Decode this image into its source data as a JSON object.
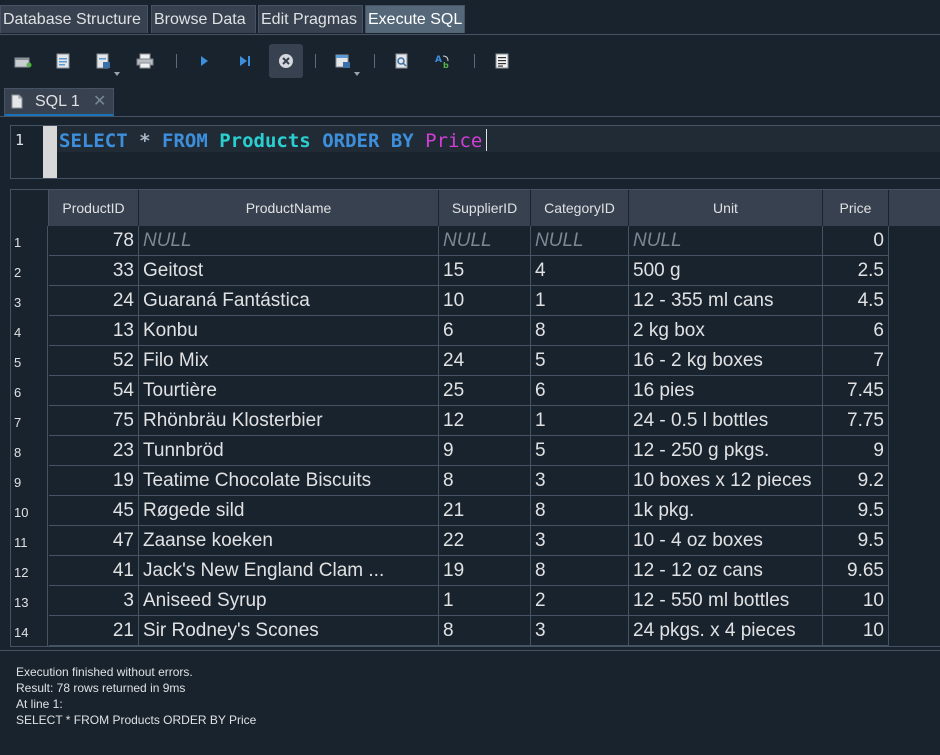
{
  "main_tabs": [
    {
      "label": "Database Structure",
      "active": false
    },
    {
      "label": "Browse Data",
      "active": false
    },
    {
      "label": "Edit Pragmas",
      "active": false
    },
    {
      "label": "Execute SQL",
      "active": true
    }
  ],
  "toolbar": {
    "buttons": [
      "open-tab-icon",
      "open-sql-file-icon",
      "save-sql-file-icon",
      "print-icon",
      "execute-all-icon",
      "execute-line-icon",
      "stop-execution-icon",
      "save-results-icon",
      "find-icon",
      "find-replace-icon",
      "comment-icon"
    ]
  },
  "sql_tab": {
    "label": "SQL 1",
    "close": "✕"
  },
  "editor": {
    "line_number": "1",
    "tokens": {
      "select": "SELECT",
      "star": "*",
      "from": "FROM",
      "table": "Products",
      "order_by": "ORDER BY",
      "column": "Price"
    }
  },
  "results": {
    "columns": [
      "ProductID",
      "ProductName",
      "SupplierID",
      "CategoryID",
      "Unit",
      "Price"
    ],
    "rows": [
      {
        "n": "1",
        "id": "78",
        "name": "NULL",
        "supplier": "NULL",
        "category": "NULL",
        "unit": "NULL",
        "price": "0"
      },
      {
        "n": "2",
        "id": "33",
        "name": "Geitost",
        "supplier": "15",
        "category": "4",
        "unit": "500 g",
        "price": "2.5"
      },
      {
        "n": "3",
        "id": "24",
        "name": "Guaraná Fantástica",
        "supplier": "10",
        "category": "1",
        "unit": "12 - 355 ml cans",
        "price": "4.5"
      },
      {
        "n": "4",
        "id": "13",
        "name": "Konbu",
        "supplier": "6",
        "category": "8",
        "unit": "2 kg box",
        "price": "6"
      },
      {
        "n": "5",
        "id": "52",
        "name": "Filo Mix",
        "supplier": "24",
        "category": "5",
        "unit": "16 - 2 kg boxes",
        "price": "7"
      },
      {
        "n": "6",
        "id": "54",
        "name": "Tourtière",
        "supplier": "25",
        "category": "6",
        "unit": "16 pies",
        "price": "7.45"
      },
      {
        "n": "7",
        "id": "75",
        "name": "Rhönbräu Klosterbier",
        "supplier": "12",
        "category": "1",
        "unit": "24 - 0.5 l bottles",
        "price": "7.75"
      },
      {
        "n": "8",
        "id": "23",
        "name": "Tunnbröd",
        "supplier": "9",
        "category": "5",
        "unit": "12 - 250 g pkgs.",
        "price": "9"
      },
      {
        "n": "9",
        "id": "19",
        "name": "Teatime Chocolate Biscuits",
        "supplier": "8",
        "category": "3",
        "unit": "10 boxes x 12 pieces",
        "price": "9.2"
      },
      {
        "n": "10",
        "id": "45",
        "name": "Røgede sild",
        "supplier": "21",
        "category": "8",
        "unit": "1k pkg.",
        "price": "9.5"
      },
      {
        "n": "11",
        "id": "47",
        "name": "Zaanse koeken",
        "supplier": "22",
        "category": "3",
        "unit": "10 - 4 oz boxes",
        "price": "9.5"
      },
      {
        "n": "12",
        "id": "41",
        "name": "Jack's New England Clam ...",
        "supplier": "19",
        "category": "8",
        "unit": "12 - 12 oz cans",
        "price": "9.65"
      },
      {
        "n": "13",
        "id": "3",
        "name": "Aniseed Syrup",
        "supplier": "1",
        "category": "2",
        "unit": "12 - 550 ml bottles",
        "price": "10"
      },
      {
        "n": "14",
        "id": "21",
        "name": "Sir Rodney's Scones",
        "supplier": "8",
        "category": "3",
        "unit": "24 pkgs. x 4 pieces",
        "price": "10"
      }
    ]
  },
  "output": {
    "line1": "Execution finished without errors.",
    "line2": "Result: 78 rows returned in 9ms",
    "line3": "At line 1:",
    "line4": "SELECT * FROM Products ORDER BY Price"
  }
}
